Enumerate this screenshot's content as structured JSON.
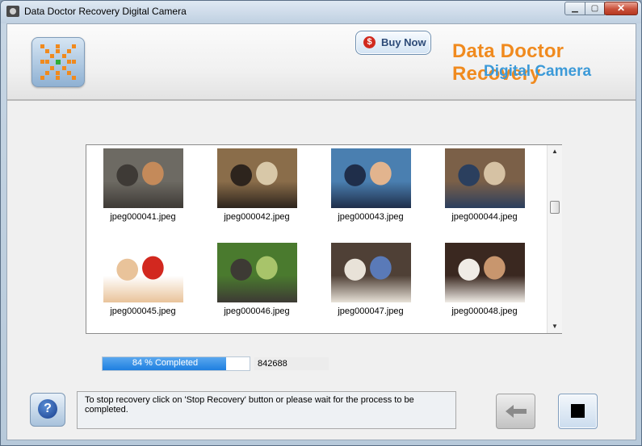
{
  "window": {
    "title": "Data Doctor Recovery Digital Camera",
    "controls": {
      "minimize_icon": "minimize-icon",
      "maximize_icon": "maximize-icon",
      "close_icon": "close-icon"
    }
  },
  "header": {
    "buy_now_label": "Buy Now",
    "buy_now_icon": "dollar-icon",
    "brand_line1": "Data Doctor Recovery",
    "brand_line2": "Digital Camera",
    "colors": {
      "brand_orange": "#f08a1e",
      "brand_blue": "#3c9ad8"
    }
  },
  "gallery": {
    "files": [
      {
        "name": "jpeg000041.jpeg",
        "palette": [
          "#6d6a63",
          "#c48a5a",
          "#3e3a36"
        ]
      },
      {
        "name": "jpeg000042.jpeg",
        "palette": [
          "#8a6d4a",
          "#d8c8a8",
          "#2d241d"
        ]
      },
      {
        "name": "jpeg000043.jpeg",
        "palette": [
          "#4a7fb0",
          "#e2b48e",
          "#1f2e4a"
        ]
      },
      {
        "name": "jpeg000044.jpeg",
        "palette": [
          "#7b6048",
          "#d6c2a4",
          "#2b3f5e"
        ]
      },
      {
        "name": "jpeg000045.jpeg",
        "palette": [
          "#ffffff",
          "#d2281f",
          "#e9c39a"
        ]
      },
      {
        "name": "jpeg000046.jpeg",
        "palette": [
          "#4a7a2e",
          "#a8c46a",
          "#3d3a34"
        ]
      },
      {
        "name": "jpeg000047.jpeg",
        "palette": [
          "#4f4036",
          "#5a7ab8",
          "#e8e2d8"
        ]
      },
      {
        "name": "jpeg000048.jpeg",
        "palette": [
          "#3a2820",
          "#c8966e",
          "#f0ece6"
        ]
      }
    ]
  },
  "progress": {
    "percent": 84,
    "label": "84 % Completed",
    "count": "842688"
  },
  "footer": {
    "status_message": "To stop recovery click on 'Stop Recovery' button or please wait for the process to be completed.",
    "help_icon": "help-icon",
    "back_icon": "back-arrow-icon",
    "stop_icon": "stop-icon"
  }
}
